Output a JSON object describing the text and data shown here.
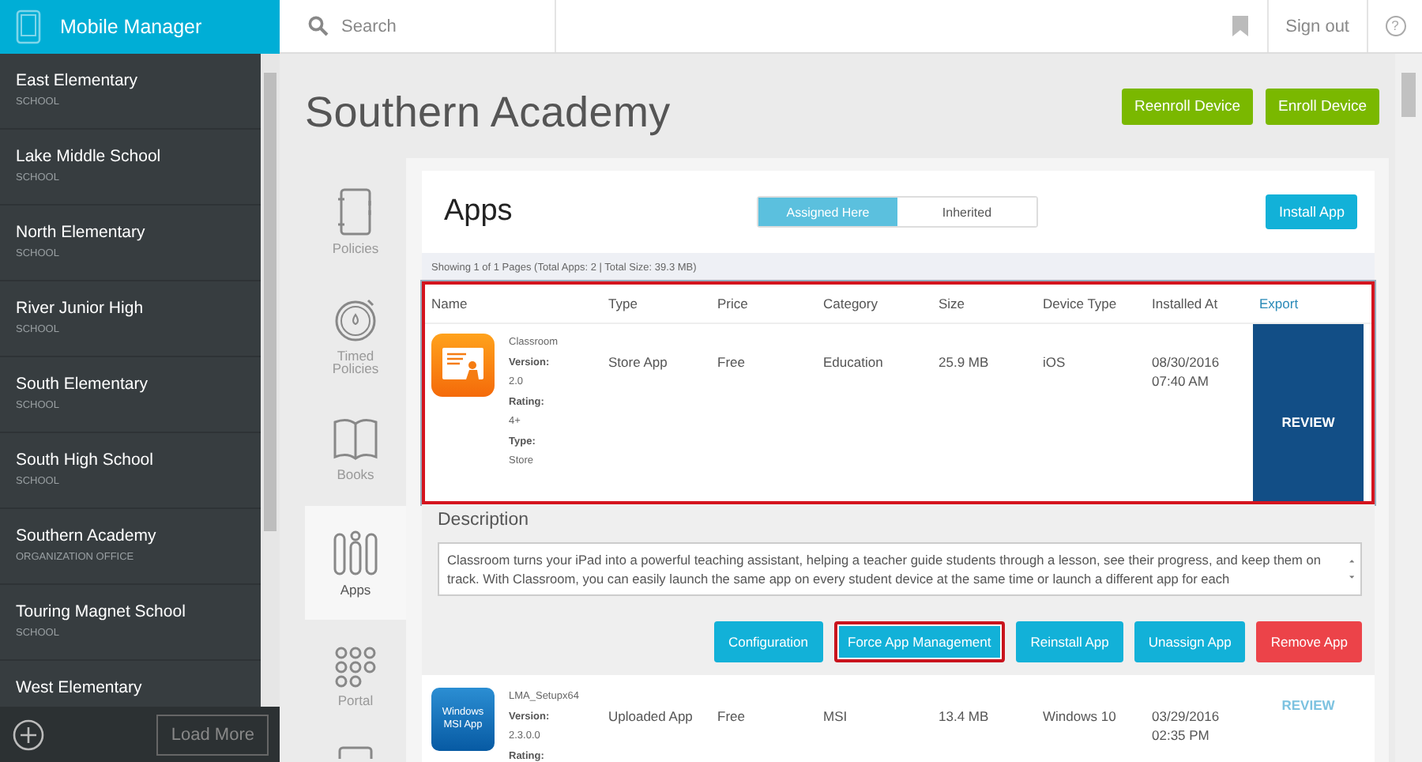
{
  "app_title": "Mobile Manager",
  "search": {
    "placeholder": "Search"
  },
  "sign_out": "Sign out",
  "help": "?",
  "sidebar": {
    "items": [
      {
        "name": "East Elementary",
        "type": "SCHOOL"
      },
      {
        "name": "Lake Middle School",
        "type": "SCHOOL"
      },
      {
        "name": "North Elementary",
        "type": "SCHOOL"
      },
      {
        "name": "River Junior High",
        "type": "SCHOOL"
      },
      {
        "name": "South Elementary",
        "type": "SCHOOL"
      },
      {
        "name": "South High School",
        "type": "SCHOOL"
      },
      {
        "name": "Southern Academy",
        "type": "ORGANIZATION OFFICE"
      },
      {
        "name": "Touring Magnet School",
        "type": "SCHOOL"
      },
      {
        "name": "West Elementary"
      }
    ],
    "load_more": "Load More"
  },
  "page_title": "Southern Academy",
  "header_buttons": [
    "Reenroll Device",
    "Enroll Device"
  ],
  "nav_tabs": [
    {
      "kind": "notebook",
      "label": "Policies",
      "selected": false
    },
    {
      "kind": "timer",
      "label": "Timed Policies",
      "selected": false
    },
    {
      "kind": "book",
      "label": "Books",
      "selected": false
    },
    {
      "kind": "tools",
      "label": "Apps",
      "selected": true
    },
    {
      "kind": "dots",
      "label": "Portal",
      "selected": false
    },
    {
      "kind": "device",
      "selected": false
    }
  ],
  "apps": {
    "title": "Apps",
    "toggle": [
      {
        "label": "Assigned Here",
        "selected": true
      },
      {
        "label": "Inherited",
        "selected": false
      }
    ],
    "install_button": "Install App",
    "summary": "Showing 1 of 1 Pages (Total Apps: 2 | Total Size: 39.3 MB)",
    "table": {
      "columns": [
        "Name",
        "Type",
        "Price",
        "Category",
        "Size",
        "Device Type",
        "Installed At",
        "Export"
      ],
      "rows": [
        {
          "kind": "classroom",
          "name": "Classroom",
          "details": [
            {
              "label": "Version:",
              "value": "2.0"
            },
            {
              "label": "Rating:",
              "value": "4+"
            },
            {
              "label": "Type:",
              "value": "Store"
            }
          ],
          "type": "Store App",
          "price": "Free",
          "category": "Education",
          "size": "25.9 MB",
          "device_type": "iOS",
          "installed_at": "08/30/2016 07:40 AM",
          "action": "REVIEW",
          "selected": true,
          "highlighted": true,
          "description_title": "Description",
          "description": "Classroom turns your iPad into a powerful teaching assistant, helping a teacher guide students through a lesson, see their progress, and keep them on track. With Classroom, you can easily launch the same app on every student device at the same time or launch a different app for each",
          "buttons": [
            {
              "label": "Configuration",
              "kind": "primary",
              "highlighted": false
            },
            {
              "label": "Force App Management",
              "kind": "primary",
              "highlighted": true
            },
            {
              "label": "Reinstall App",
              "kind": "primary",
              "highlighted": false
            },
            {
              "label": "Unassign App",
              "kind": "primary",
              "highlighted": false
            },
            {
              "label": "Remove App",
              "kind": "danger",
              "highlighted": false
            }
          ]
        },
        {
          "kind": "msi",
          "icon_text": "Windows MSI App",
          "name": "LMA_Setupx64",
          "details": [
            {
              "label": "Version:",
              "value": "2.3.0.0"
            },
            {
              "label": "Rating:"
            }
          ],
          "type": "Uploaded App",
          "price": "Free",
          "category": "MSI",
          "size": "13.4 MB",
          "device_type": "Windows 10",
          "installed_at": "03/29/2016 02:35 PM",
          "action": "REVIEW",
          "selected": false,
          "highlighted": false
        }
      ]
    }
  }
}
